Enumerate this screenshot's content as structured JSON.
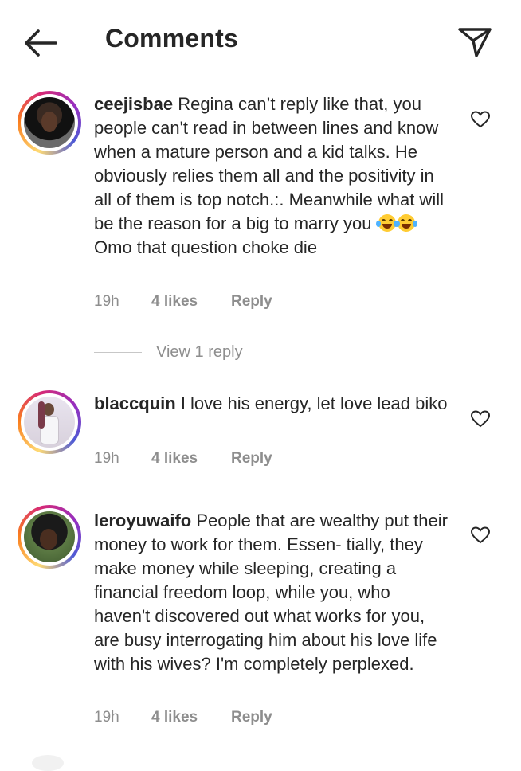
{
  "header": {
    "title": "Comments",
    "back_icon": "arrow-left-icon",
    "share_icon": "paper-plane-icon"
  },
  "comments": [
    {
      "username": "ceejisbae",
      "text": "Regina can’t reply like that, you people can't read in between lines and know when a mature person and a kid talks. He obviously relies them all and the positivity in all of them is top notch.:. Meanwhile what will be the reason for a big to marry you",
      "emoji": "😂😂",
      "text_after_emoji": "Omo that question choke die",
      "time": "19h",
      "likes": "4 likes",
      "reply": "Reply",
      "view_replies": "View 1 reply"
    },
    {
      "username": "blaccquin",
      "text": "I love his energy, let love lead biko",
      "time": "19h",
      "likes": "4 likes",
      "reply": "Reply"
    },
    {
      "username": "leroyuwaifo",
      "text": "People that are wealthy put their money to work for them. Essen- tially, they make money while sleeping, creating a financial freedom loop, while you, who haven't discovered out what works for you, are busy interrogating him about his love life with his wives? I'm completely perplexed.",
      "time": "19h",
      "likes": "4 likes",
      "reply": "Reply"
    }
  ],
  "colors": {
    "text": "#262626",
    "secondary": "#8e8e8e",
    "story_ring": [
      "#feda75",
      "#fa7e1e",
      "#d62976",
      "#962fbf"
    ]
  }
}
